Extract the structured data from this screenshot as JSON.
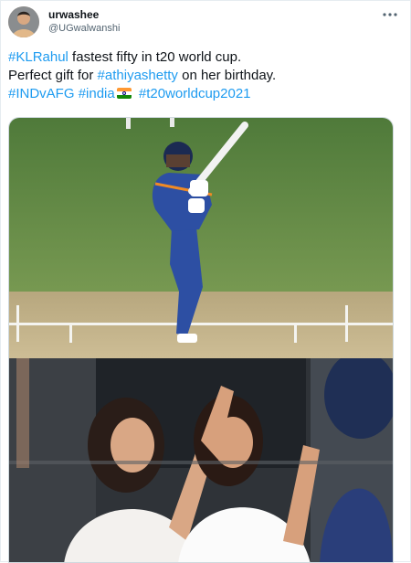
{
  "tweet": {
    "author": {
      "display_name": "urwashee",
      "handle": "@UGwalwanshi",
      "avatar_icon": "avatar-photo"
    },
    "more_icon": "more-options-icon",
    "text": {
      "line1_tag": "#KLRahul",
      "line1_rest": " fastest fifty in t20 world cup.",
      "line2_start": "Perfect gift for ",
      "line2_tag": "#athiyashetty",
      "line2_rest": " on her birthday.",
      "line3_tag1": "#INDvAFG",
      "line3_tag2": "#india",
      "line3_flag": "india-flag-emoji",
      "line3_tag3": "#t20worldcup2021"
    },
    "media": {
      "top_image": "cricket-batsman-on-pitch",
      "bottom_image": "crowd-applauding-in-stands"
    },
    "colors": {
      "link": "#1d9bf0",
      "text": "#0f1419",
      "secondary": "#536471"
    }
  }
}
